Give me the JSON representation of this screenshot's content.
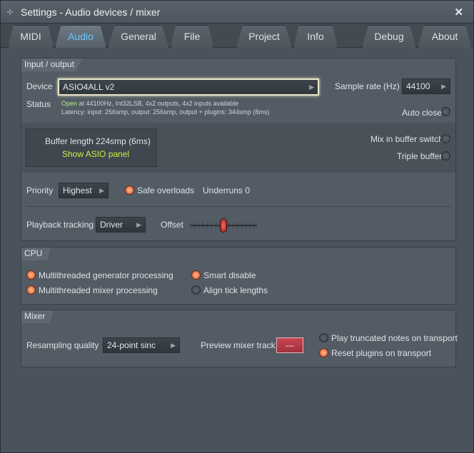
{
  "window": {
    "title": "Settings - Audio devices / mixer",
    "close_label": "✕"
  },
  "tabs": [
    {
      "label": "MIDI"
    },
    {
      "label": "Audio"
    },
    {
      "label": "General"
    },
    {
      "label": "File"
    },
    {
      "label": "Project"
    },
    {
      "label": "Info"
    },
    {
      "label": "Debug"
    },
    {
      "label": "About"
    }
  ],
  "io": {
    "section_label": "Input / output",
    "device_label": "Device",
    "device_value": "ASIO4ALL v2",
    "sample_rate_label": "Sample rate (Hz)",
    "sample_rate_value": "44100",
    "status_label": "Status",
    "status_open": "Open",
    "status_line1": " at 44100Hz, Int32LSB, 4x2 outputs, 4x2 inputs available",
    "status_line2": "Latency: input: 256smp, output: 256smp, output + plugins: 344smp (8ms)",
    "auto_close_label": "Auto close",
    "buffer_length": "Buffer length 224smp (6ms)",
    "show_asio": "Show ASIO panel",
    "mix_in_buffer_label": "Mix in buffer switch",
    "triple_buffer_label": "Triple buffer",
    "priority_label": "Priority",
    "priority_value": "Highest",
    "safe_overloads_label": "Safe overloads",
    "underruns_label": "Underruns 0",
    "playback_tracking_label": "Playback tracking",
    "playback_tracking_value": "Driver",
    "offset_label": "Offset"
  },
  "cpu": {
    "section_label": "CPU",
    "mt_generator": "Multithreaded generator processing",
    "mt_mixer": "Multithreaded mixer processing",
    "smart_disable": "Smart disable",
    "align_tick": "Align tick lengths"
  },
  "mixer": {
    "section_label": "Mixer",
    "resampling_label": "Resampling quality",
    "resampling_value": "24-point sinc",
    "preview_label": "Preview mixer track",
    "preview_value": "---",
    "play_truncated": "Play truncated notes on transport",
    "reset_plugins": "Reset plugins on transport"
  },
  "icons": {
    "window_icon": "move-icon",
    "close": "close-icon",
    "dropdown": "triangle-right-icon"
  },
  "colors": {
    "accent_tab": "#6ec6ff",
    "status_open": "#b5f07a",
    "radio_on": "#f07a4c",
    "preview_btn": "#c94553"
  }
}
